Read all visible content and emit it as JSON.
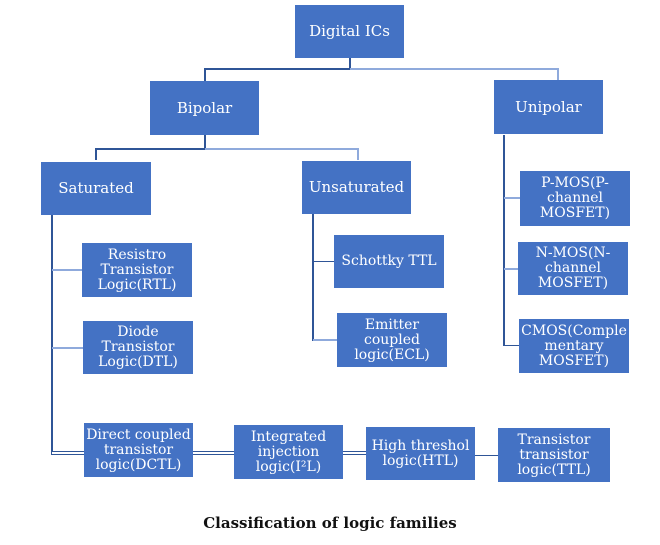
{
  "diagram": {
    "title": "Classification of logic families",
    "colors": {
      "node_fill": "#4472C4",
      "node_text": "#FFFFFF",
      "connector_dark": "#2F5597",
      "connector_light": "#8FAADC"
    },
    "root": {
      "label": "Digital ICs"
    },
    "level1": {
      "bipolar": {
        "label": "Bipolar"
      },
      "unipolar": {
        "label": "Unipolar"
      }
    },
    "level2": {
      "saturated": {
        "label": "Saturated"
      },
      "unsaturated": {
        "label": "Unsaturated"
      }
    },
    "saturated_children": [
      {
        "lines": [
          "Resistro",
          "Transistor",
          "Logic(RTL)"
        ]
      },
      {
        "lines": [
          "Diode",
          "Transistor",
          "Logic(DTL)"
        ]
      }
    ],
    "unsaturated_children": [
      {
        "lines": [
          "Schottky TTL"
        ]
      },
      {
        "lines": [
          "Emitter",
          "coupled",
          "logic(ECL)"
        ]
      }
    ],
    "unipolar_children": [
      {
        "lines": [
          "P-MOS(P-",
          "channel",
          "MOSFET)"
        ]
      },
      {
        "lines": [
          "N-MOS(N-",
          "channel",
          "MOSFET)"
        ]
      },
      {
        "lines": [
          "CMOS(Comple",
          "mentary",
          "MOSFET)"
        ]
      }
    ],
    "bottom_row": [
      {
        "lines": [
          "Direct coupled",
          "transistor",
          "logic(DCTL)"
        ]
      },
      {
        "lines": [
          "Integrated",
          "injection",
          "logic(I²L)"
        ]
      },
      {
        "lines": [
          "High threshol",
          "logic(HTL)"
        ]
      },
      {
        "lines": [
          "Transistor",
          "transistor",
          "logic(TTL)"
        ]
      }
    ],
    "edges": [
      [
        "Digital ICs",
        "Bipolar"
      ],
      [
        "Digital ICs",
        "Unipolar"
      ],
      [
        "Bipolar",
        "Saturated"
      ],
      [
        "Bipolar",
        "Unsaturated"
      ],
      [
        "Saturated",
        "Resistro Transistor Logic(RTL)"
      ],
      [
        "Saturated",
        "Diode Transistor Logic(DTL)"
      ],
      [
        "Saturated",
        "Direct coupled transistor logic(DCTL)"
      ],
      [
        "Direct coupled transistor logic(DCTL)",
        "Integrated injection logic(I²L)"
      ],
      [
        "Integrated injection logic(I²L)",
        "High threshol logic(HTL)"
      ],
      [
        "High threshol logic(HTL)",
        "Transistor transistor logic(TTL)"
      ],
      [
        "Unsaturated",
        "Schottky TTL"
      ],
      [
        "Unsaturated",
        "Emitter coupled logic(ECL)"
      ],
      [
        "Unipolar",
        "P-MOS(P-channel MOSFET)"
      ],
      [
        "Unipolar",
        "N-MOS(N-channel MOSFET)"
      ],
      [
        "Unipolar",
        "CMOS(Complementary MOSFET)"
      ]
    ]
  }
}
